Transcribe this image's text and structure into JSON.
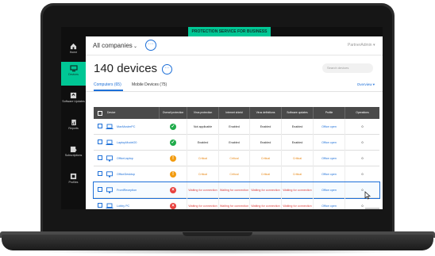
{
  "banner": "PROTECTION SERVICE FOR BUSINESS",
  "sidebar": {
    "items": [
      {
        "label": "Home",
        "icon": "home-icon"
      },
      {
        "label": "Devices",
        "icon": "devices-icon",
        "active": true
      },
      {
        "label": "Software Updates",
        "icon": "software-updates-icon"
      },
      {
        "label": "Reports",
        "icon": "reports-icon"
      },
      {
        "label": "Subscriptions",
        "icon": "subscriptions-icon"
      },
      {
        "label": "Profiles",
        "icon": "profiles-icon"
      }
    ]
  },
  "header": {
    "company_select": "All companies",
    "company_chevron": "⌄",
    "more": "···",
    "user": "PartnerAdmin ▾"
  },
  "page": {
    "title": "140 devices",
    "more": "···",
    "search_placeholder": "Search devices"
  },
  "tabs": {
    "computers": "Computers (65)",
    "mobile": "Mobile Devices (75)",
    "overview": "Overview ▾"
  },
  "table": {
    "headers": [
      "Device",
      "Overall protection",
      "Virus protection",
      "Internet shield",
      "Virus definitions",
      "Software updates",
      "Profile",
      "Operations"
    ],
    "rows": [
      {
        "device": "MaxMusterPC",
        "device_icon": "laptop-icon",
        "status": "ok",
        "virus": "Not applicable",
        "internet": "Enabled",
        "defs": "Enabled",
        "sw": "Enabled",
        "profile": "Office open",
        "ops": "0",
        "tone": "normal"
      },
      {
        "device": "LaptopModel20",
        "device_icon": "laptop-icon",
        "status": "ok",
        "virus": "Enabled",
        "internet": "Enabled",
        "defs": "Enabled",
        "sw": "Enabled",
        "profile": "Office open",
        "ops": "0",
        "tone": "normal"
      },
      {
        "device": "OfficeLaptop",
        "device_icon": "desktop-icon",
        "status": "warn",
        "virus": "Critical",
        "internet": "Critical",
        "defs": "Critical",
        "sw": "Critical",
        "profile": "Office open",
        "ops": "0",
        "tone": "orange"
      },
      {
        "device": "OfficeDesktop",
        "device_icon": "desktop-icon",
        "status": "warn",
        "virus": "Critical",
        "internet": "Critical",
        "defs": "Critical",
        "sw": "Critical",
        "profile": "Office open",
        "ops": "0",
        "tone": "orange"
      },
      {
        "device": "FrontReception",
        "device_icon": "desktop-icon",
        "status": "crit",
        "virus": "Waiting for connection",
        "internet": "Waiting for connection",
        "defs": "Waiting for connection",
        "sw": "Waiting for connection",
        "profile": "Office open",
        "ops": "0",
        "tone": "red",
        "selected": true
      },
      {
        "device": "Lobby PC",
        "device_icon": "laptop-icon",
        "status": "crit",
        "virus": "Waiting for connection",
        "internet": "Waiting for connection",
        "defs": "Waiting for connection",
        "sw": "Waiting for connection",
        "profile": "Office open",
        "ops": "0",
        "tone": "red"
      }
    ]
  },
  "colors": {
    "accent": "#00c795",
    "link": "#1c6fd8",
    "ok": "#1fab4a",
    "warn": "#f29b0f",
    "crit": "#e8423f"
  }
}
